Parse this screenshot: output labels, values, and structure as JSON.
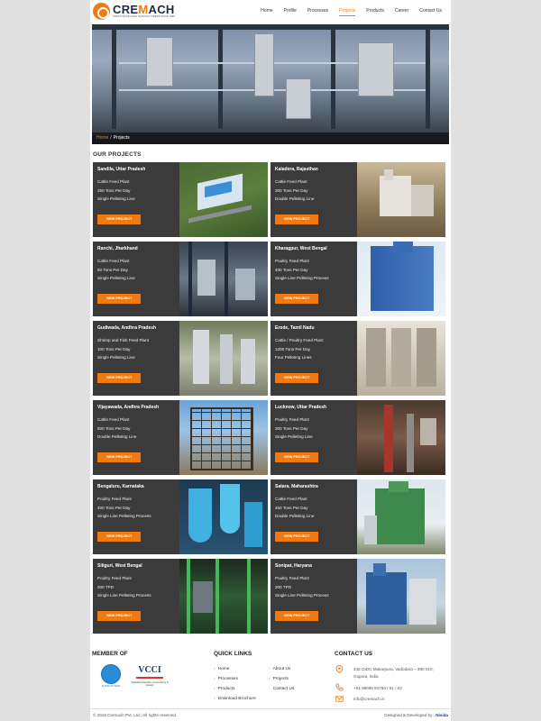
{
  "brand": {
    "name_prefix": "CRE",
    "name_accent": "M",
    "name_suffix": "ACH",
    "tagline": "CREATIVE MACHINE MANUFACTURERS SINCE 1990"
  },
  "nav": [
    "Home",
    "Profile",
    "Processes",
    "Projects",
    "Products",
    "Career",
    "Contact Us"
  ],
  "nav_active": "Projects",
  "breadcrumb": {
    "home": "Home",
    "separator": "/",
    "current": "Projects"
  },
  "section_title": "OUR PROJECTS",
  "button_label": "VIEW PROJECT",
  "projects": [
    {
      "location": "Sandila, Uttar Pradesh",
      "lines": [
        "Cattle Feed Plant",
        "250 Tons Per Day",
        "Single Pelleting Line"
      ]
    },
    {
      "location": "Kaladera, Rajasthan",
      "lines": [
        "Cattle Feed Plant",
        "300 Tons Per Day",
        "Double Pelleting Line"
      ]
    },
    {
      "location": "Ranchi, Jharkhand",
      "lines": [
        "Cattle Feed Plant",
        "50 Tons Per Day",
        "Single Pelleting Line"
      ]
    },
    {
      "location": "Kharagpur, West Bengal",
      "lines": [
        "Poultry Feed Plant",
        "400 Tons Per Day",
        "Single Line Pelleting Process"
      ]
    },
    {
      "location": "Gudiwada, Andhra Pradesh",
      "lines": [
        "Shrimp and Fish Feed Plant",
        "100 Tons Per Day",
        "Single Pelleting Line"
      ]
    },
    {
      "location": "Erode, Tamil Nadu",
      "lines": [
        "Cattle / Poultry Feed Plant",
        "1200 Tons Per Day",
        "Four Pelleting Lines"
      ]
    },
    {
      "location": "Vijayawada, Andhra Pradesh",
      "lines": [
        "Cattle Feed Plant",
        "500 Tons Per Day",
        "Double Pelleting Line"
      ]
    },
    {
      "location": "Lucknow, Uttar Pradesh",
      "lines": [
        "Poultry Feed Plant",
        "300 Tons Per Day",
        "Single Pelleting Line"
      ]
    },
    {
      "location": "Bengaluru, Karnataka",
      "lines": [
        "Poultry Feed Plant",
        "400 Tons Per Day",
        "Single Line Pelleting Process"
      ]
    },
    {
      "location": "Satara, Maharashtra",
      "lines": [
        "Cattle Feed Plant",
        "450 Tons Per Day",
        "Double Pelleting Line"
      ]
    },
    {
      "location": "Siliguri, West Bengal",
      "lines": [
        "Poultry Feed Plant",
        "200 TPD",
        "Single Line Pelleting Process"
      ]
    },
    {
      "location": "Sonipat, Haryana",
      "lines": [
        "Poultry Feed Plant",
        "200 TPD",
        "Single Line Pelleting Process"
      ]
    }
  ],
  "footer": {
    "member_title": "MEMBER OF",
    "members": [
      {
        "logo_text": "CLFMA",
        "caption": "CLFMA OF INDIA"
      },
      {
        "logo_text": "VCCI",
        "caption": "Vadodara Chamber of Commerce & Industry"
      }
    ],
    "quick_links_title": "QUICK LINKS",
    "quick_links": [
      "Home",
      "About Us",
      "Processes",
      "Projects",
      "Products",
      "Contact Us",
      "Download Brochure"
    ],
    "contact_title": "CONTACT US",
    "address_line1": "446 GIDC Makarpura, Vadodara – 390 010,",
    "address_line2": "Gujarat, India",
    "phone": "+91 99099 84760 / 61 / 63",
    "email": "info@cremach.in",
    "copyright": "© 2018 Cremach Pvt. Ltd., All rights reserved.",
    "developer_prefix": "Designed & Developed by :",
    "developer": "Nivida"
  },
  "colors": {
    "accent": "#f07a12",
    "card_bg": "#3b3b3b",
    "brand_navy": "#1f2a44"
  },
  "icons": [
    "location-pin-icon",
    "phone-icon",
    "mail-icon",
    "chevron-right-icon"
  ]
}
